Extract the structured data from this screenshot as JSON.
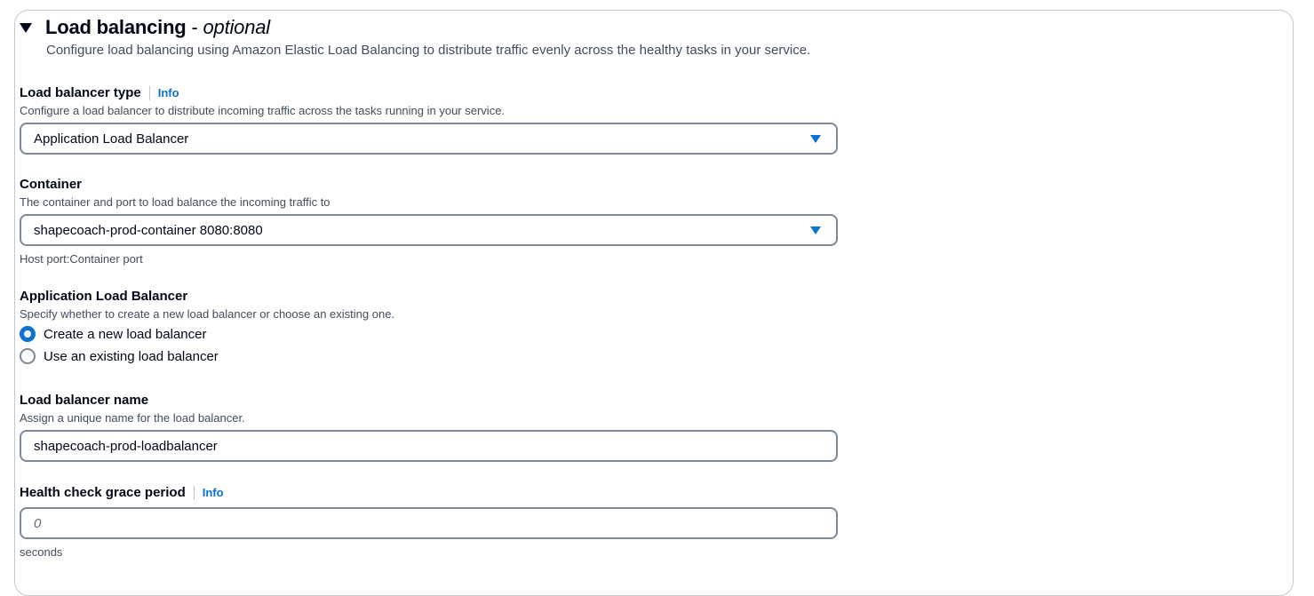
{
  "section": {
    "title": "Load balancing",
    "title_sep": " - ",
    "title_suffix": "optional",
    "description": "Configure load balancing using Amazon Elastic Load Balancing to distribute traffic evenly across the healthy tasks in your service."
  },
  "lb_type": {
    "label": "Load balancer type",
    "info": "Info",
    "description": "Configure a load balancer to distribute incoming traffic across the tasks running in your service.",
    "selected": "Application Load Balancer"
  },
  "container": {
    "label": "Container",
    "description": "The container and port to load balance the incoming traffic to",
    "selected": "shapecoach-prod-container 8080:8080",
    "constraint": "Host port:Container port"
  },
  "alb": {
    "label": "Application Load Balancer",
    "description": "Specify whether to create a new load balancer or choose an existing one.",
    "options": [
      {
        "label": "Create a new load balancer",
        "checked": true
      },
      {
        "label": "Use an existing load balancer",
        "checked": false
      }
    ]
  },
  "lb_name": {
    "label": "Load balancer name",
    "description": "Assign a unique name for the load balancer.",
    "value": "shapecoach-prod-loadbalancer"
  },
  "health_check": {
    "label": "Health check grace period",
    "info": "Info",
    "placeholder": "0",
    "constraint": "seconds"
  },
  "colors": {
    "accent": "#0972d3",
    "text": "#000716",
    "secondary_text": "#414d5c",
    "border": "#7d8998"
  }
}
